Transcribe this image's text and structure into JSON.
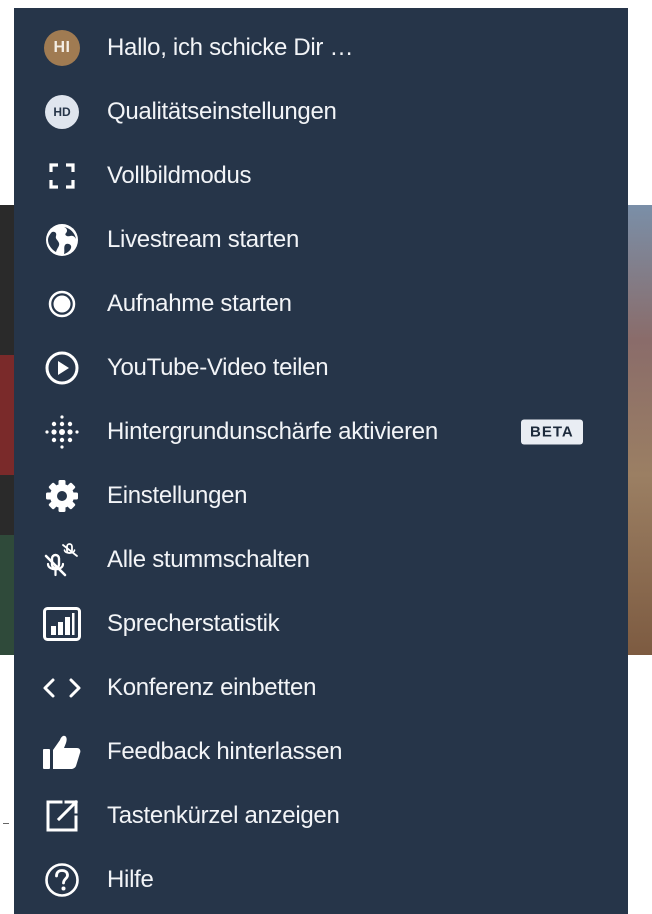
{
  "menu": {
    "items": [
      {
        "id": "profile",
        "label": "Hallo, ich schicke Dir …",
        "icon": "avatar",
        "avatar_text": "HI"
      },
      {
        "id": "quality",
        "label": "Qualitätseinstellungen",
        "icon": "hd-icon",
        "icon_text": "HD"
      },
      {
        "id": "fullscreen",
        "label": "Vollbildmodus",
        "icon": "fullscreen-icon"
      },
      {
        "id": "livestream",
        "label": "Livestream starten",
        "icon": "globe-icon"
      },
      {
        "id": "recording",
        "label": "Aufnahme starten",
        "icon": "record-icon"
      },
      {
        "id": "youtube",
        "label": "YouTube-Video teilen",
        "icon": "play-circle-icon"
      },
      {
        "id": "blur",
        "label": "Hintergrundunschärfe aktivieren",
        "icon": "blur-dots-icon",
        "badge": "BETA"
      },
      {
        "id": "settings",
        "label": "Einstellungen",
        "icon": "gear-icon"
      },
      {
        "id": "muteall",
        "label": "Alle stummschalten",
        "icon": "mute-all-icon"
      },
      {
        "id": "stats",
        "label": "Sprecherstatistik",
        "icon": "bar-chart-icon"
      },
      {
        "id": "embed",
        "label": "Konferenz einbetten",
        "icon": "code-icon"
      },
      {
        "id": "feedback",
        "label": "Feedback hinterlassen",
        "icon": "thumbs-up-icon"
      },
      {
        "id": "shortcuts",
        "label": "Tastenkürzel anzeigen",
        "icon": "external-link-icon"
      },
      {
        "id": "help",
        "label": "Hilfe",
        "icon": "help-icon"
      }
    ]
  },
  "colors": {
    "menu_background": "#263549",
    "text": "#f2f4f7",
    "avatar_background": "#a07b52",
    "badge_background": "#e9edf3"
  }
}
